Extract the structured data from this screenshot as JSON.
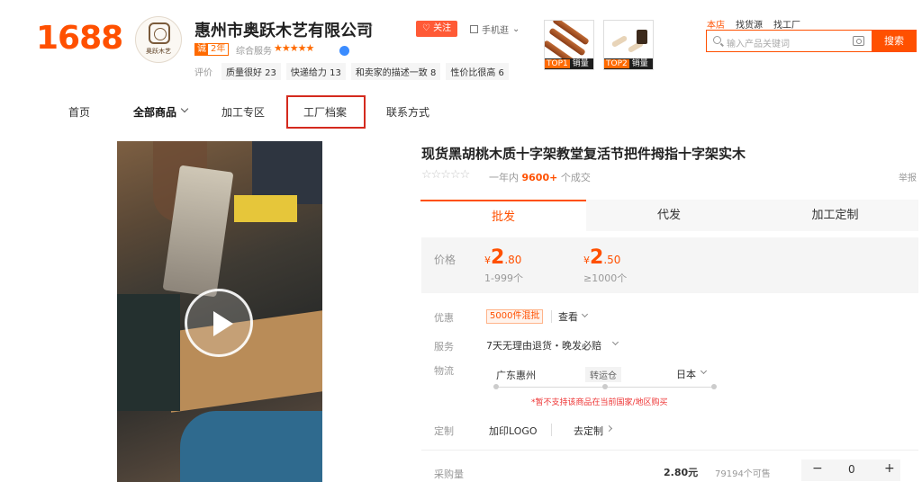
{
  "header": {
    "logo": "1688",
    "shop_avatar_text": "奥跃木艺",
    "shop_name": "惠州市奥跃木艺有限公司",
    "cheng_badge_left": "诚",
    "cheng_badge_right": "2年",
    "score_label": "综合服务",
    "score_stars": "★★★★★",
    "rating_label": "评价",
    "ratings": [
      "质量很好 23",
      "快递给力 13",
      "和卖家的描述一致 8",
      "性价比很高 6"
    ],
    "follow_label": "关注",
    "mobile_label": "手机逛",
    "thumbs": [
      {
        "rank": "TOP1",
        "label": "销量"
      },
      {
        "rank": "TOP2",
        "label": "销量"
      }
    ],
    "search_scopes": [
      "本店",
      "找货源",
      "找工厂"
    ],
    "search_placeholder": "输入产品关键词",
    "search_button": "搜索",
    "accent_color": "#ff5000"
  },
  "nav": {
    "items": [
      "首页",
      "全部商品",
      "加工专区",
      "工厂档案",
      "联系方式"
    ]
  },
  "product": {
    "title": "现货黑胡桃木质十字架教堂复活节把件拇指十字架实木",
    "stars": "☆☆☆☆☆",
    "sold_prefix": "一年内",
    "sold_count": "9600+",
    "sold_suffix": "个成交",
    "report_label": "举报",
    "tabs": [
      "批发",
      "代发",
      "加工定制"
    ],
    "price_label": "价格",
    "prices": [
      {
        "currency": "¥",
        "int": "2",
        "dec": ".80",
        "qty": "1-999个"
      },
      {
        "currency": "¥",
        "int": "2",
        "dec": ".50",
        "qty": "≥1000个"
      }
    ],
    "promo_label": "优惠",
    "promo_tag": "5000件混批",
    "view_label": "查看",
    "service_label": "服务",
    "service_text": "7天无理由退货・晚发必赔",
    "logistics_label": "物流",
    "ship_from": "广东惠州",
    "ship_via": "转运仓",
    "ship_to": "日本",
    "ship_warning": "*暂不支持该商品在当前国家/地区购买",
    "custom_label": "定制",
    "custom_items": [
      "加印LOGO",
      "去定制"
    ],
    "quantity_label": "采购量",
    "unit_price": "2.80元",
    "stock": "79194个可售",
    "quantity_value": "0",
    "minus": "−",
    "plus": "+"
  }
}
